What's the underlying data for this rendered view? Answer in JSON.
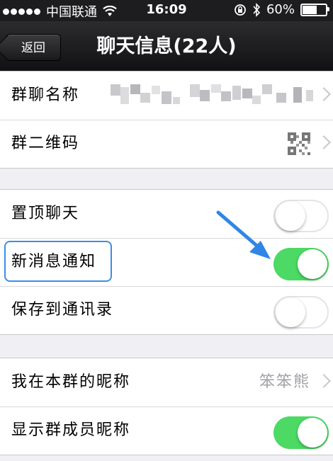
{
  "status_bar": {
    "carrier": "中国联通",
    "time": "16:09",
    "battery": "60%",
    "battery_level": 0.6,
    "icons": [
      "signal-dots-icon",
      "wifi-icon",
      "rotation-lock-icon",
      "bluetooth-icon",
      "battery-icon"
    ]
  },
  "nav": {
    "back_label": "返回",
    "title": "聊天信息(22人)"
  },
  "group1": {
    "rows": [
      {
        "label": "群聊名称",
        "value_icon": "pixelated-name"
      },
      {
        "label": "群二维码",
        "value_icon": "qr-code-icon"
      }
    ]
  },
  "group2": {
    "rows": [
      {
        "label": "置顶聊天",
        "switch_on": false
      },
      {
        "label": "新消息通知",
        "switch_on": true
      },
      {
        "label": "保存到通讯录",
        "switch_on": false
      }
    ]
  },
  "group3": {
    "rows": [
      {
        "label": "我在本群的昵称",
        "value": "笨笨熊"
      },
      {
        "label": "显示群成员昵称",
        "switch_on": true
      }
    ]
  },
  "colors": {
    "switch_on": "#4cd964",
    "highlight": "#3a8ee6",
    "arrow": "#2f86e6",
    "navbar": "#1a1a1c"
  }
}
